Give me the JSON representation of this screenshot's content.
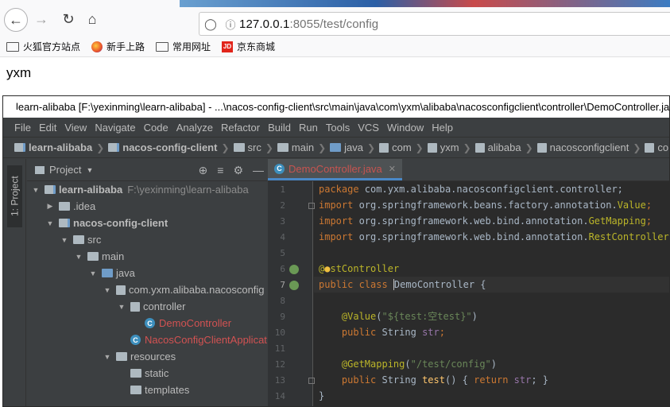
{
  "browser": {
    "url_host": "127.0.0.1",
    "url_rest": ":8055/test/config",
    "bookmarks": [
      "火狐官方站点",
      "新手上路",
      "常用网址",
      "京东商城"
    ],
    "jd_badge": "JD"
  },
  "page": {
    "body_text": "yxm"
  },
  "ide": {
    "window_title": "learn-alibaba [F:\\yexinming\\learn-alibaba] - ...\\nacos-config-client\\src\\main\\java\\com\\yxm\\alibaba\\nacosconfigclient\\controller\\DemoController.java",
    "menu": [
      "File",
      "Edit",
      "View",
      "Navigate",
      "Code",
      "Analyze",
      "Refactor",
      "Build",
      "Run",
      "Tools",
      "VCS",
      "Window",
      "Help"
    ],
    "breadcrumb": [
      "learn-alibaba",
      "nacos-config-client",
      "src",
      "main",
      "java",
      "com",
      "yxm",
      "alibaba",
      "nacosconfigclient",
      "controller"
    ],
    "side_tab": "1: Project",
    "project_header": "Project",
    "tree": [
      {
        "label": "learn-alibaba",
        "hint": "F:\\yexinming\\learn-alibaba"
      },
      {
        "label": ".idea"
      },
      {
        "label": "nacos-config-client"
      },
      {
        "label": "src"
      },
      {
        "label": "main"
      },
      {
        "label": "java"
      },
      {
        "label": "com.yxm.alibaba.nacosconfig"
      },
      {
        "label": "controller"
      },
      {
        "label": "DemoController"
      },
      {
        "label": "NacosConfigClientApplicat"
      },
      {
        "label": "resources"
      },
      {
        "label": "static"
      },
      {
        "label": "templates"
      }
    ],
    "editor_tab": "DemoController.java",
    "line_numbers": [
      "1",
      "2",
      "3",
      "4",
      "5",
      "6",
      "7",
      "8",
      "9",
      "10",
      "11",
      "12",
      "13",
      "14"
    ],
    "code": {
      "l1_kw": "package ",
      "l1_rest": "com.yxm.alibaba.nacosconfigclient.controller;",
      "l2_kw": "import ",
      "l2_pkg": "org.springframework.beans.factory.annotation.",
      "l2_cls": "Value",
      "l2_end": ";",
      "l3_kw": "import ",
      "l3_pkg": "org.springframework.web.bind.annotation.",
      "l3_cls": "GetMapping",
      "l3_end": ";",
      "l4_kw": "import ",
      "l4_pkg": "org.springframework.web.bind.annotation.",
      "l4_cls": "RestController",
      "l4_end": ";",
      "l6_at": "@",
      "l6_rest": "stController",
      "l7_kw": "public class ",
      "l7_name": "DemoController",
      "l7_end": " {",
      "l9_ann": "@Value",
      "l9_open": "(",
      "l9_str": "\"${test:空test}\"",
      "l9_close": ")",
      "l10_kw": "public ",
      "l10_type": "String ",
      "l10_var": "str",
      "l10_end": ";",
      "l12_ann": "@GetMapping",
      "l12_open": "(",
      "l12_str": "\"/test/config\"",
      "l12_close": ")",
      "l13_kw": "public ",
      "l13_type": "String ",
      "l13_fn": "test",
      "l13_mid": "() { ",
      "l13_ret": "return ",
      "l13_var": "str",
      "l13_end": "; }",
      "l14": "}"
    }
  }
}
